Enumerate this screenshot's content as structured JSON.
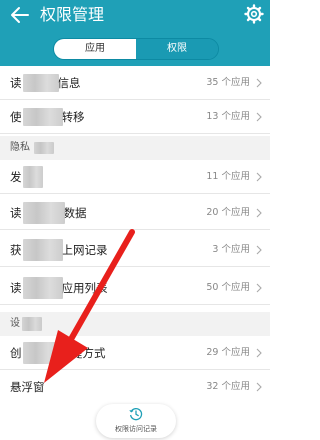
{
  "header": {
    "title": "权限管理",
    "back_icon": "back-arrow-icon",
    "settings_icon": "gear-icon",
    "background": "#1fa0b7"
  },
  "tabs": [
    {
      "label": "应用",
      "active": false
    },
    {
      "label": "权限",
      "active": true
    }
  ],
  "rows": [
    {
      "label_start": "读",
      "label_end": "信息",
      "count": "35 个应用"
    },
    {
      "label_start": "使",
      "label_end": "转移",
      "count": "13 个应用"
    },
    {
      "label_start": "发",
      "label_end": "",
      "count": "11 个应用"
    },
    {
      "label_start": "读",
      "label_end": "数据",
      "count": "20 个应用"
    },
    {
      "label_start": "获",
      "label_end": "上网记录",
      "count": "3 个应用"
    },
    {
      "label_start": "读",
      "label_end": "应用列表",
      "count": "50 个应用"
    },
    {
      "label_start": "创",
      "label_end": "快捷方式",
      "count": "29 个应用"
    },
    {
      "label_start": "悬浮窗",
      "label_end": "",
      "count": "32 个应用"
    }
  ],
  "sections": [
    {
      "label": "隐私"
    },
    {
      "label": "设"
    }
  ],
  "bottom_button": {
    "label": "权限访问记录",
    "icon": "history-clock-icon"
  },
  "annotation": {
    "color": "#e8201c",
    "icon": "red-arrow"
  }
}
